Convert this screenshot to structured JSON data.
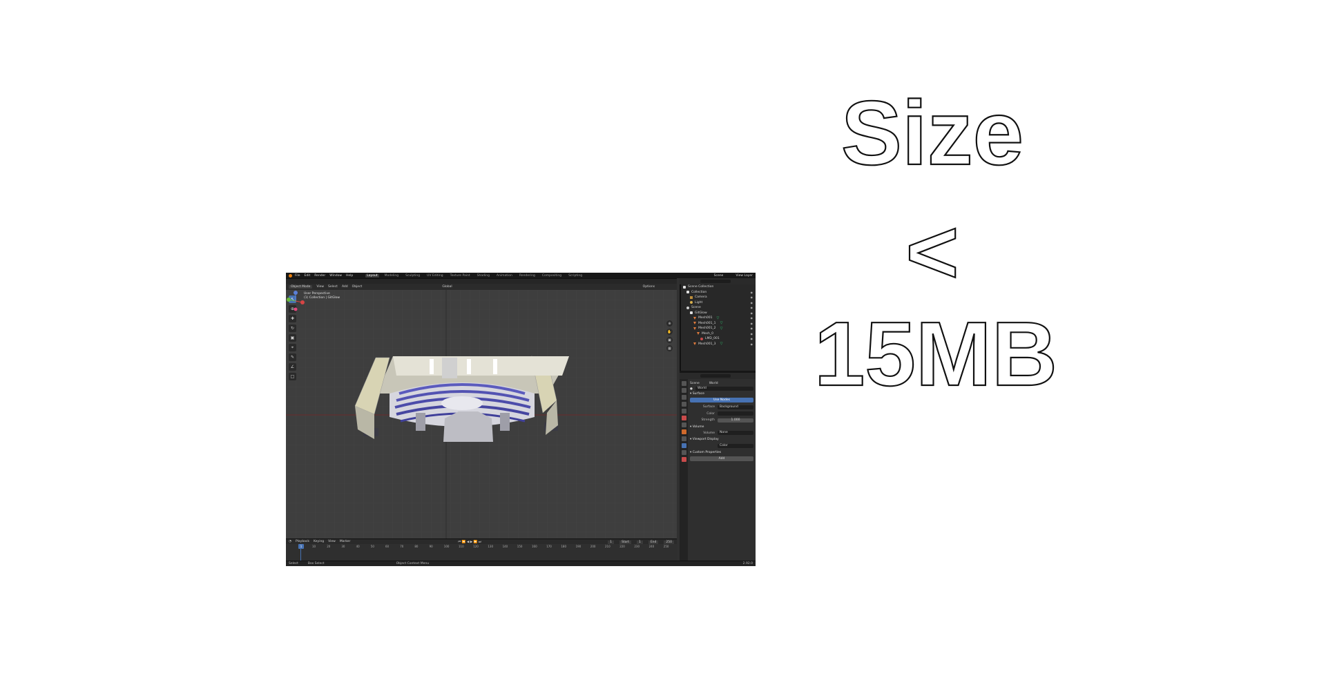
{
  "headline": {
    "line1": "Size",
    "line2": "<",
    "line3": "15MB"
  },
  "blender": {
    "menus": [
      "File",
      "Edit",
      "Render",
      "Window",
      "Help"
    ],
    "workspaces": [
      "Layout",
      "Modeling",
      "Sculpting",
      "UV Editing",
      "Texture Paint",
      "Shading",
      "Animation",
      "Rendering",
      "Compositing",
      "Scripting"
    ],
    "active_workspace": "Layout",
    "scene_name": "Scene",
    "view_layer": "View Layer",
    "viewport_header": {
      "mode": "Object Mode",
      "items": [
        "View",
        "Select",
        "Add",
        "Object"
      ],
      "transform": "Global",
      "options": "Options"
    },
    "viewport_info": {
      "line1": "User Perspective",
      "line2": "(1) Collection | GitGlow"
    },
    "timeline": {
      "menus": [
        "Playback",
        "Keying",
        "View",
        "Marker"
      ],
      "current_frame": "1",
      "start_label": "Start",
      "start_value": "1",
      "end_label": "End",
      "end_value": "250",
      "ticks": [
        "10",
        "20",
        "30",
        "40",
        "50",
        "60",
        "70",
        "80",
        "90",
        "100",
        "110",
        "120",
        "130",
        "140",
        "150",
        "160",
        "170",
        "180",
        "190",
        "200",
        "210",
        "220",
        "230",
        "240",
        "250"
      ]
    },
    "status": {
      "select": "Select",
      "box_select": "Box Select",
      "context_menu": "Object Context Menu",
      "version": "2.92.0"
    },
    "outliner": {
      "rows": [
        {
          "label": "Scene Collection",
          "indent": 0,
          "icon": "collection-icon"
        },
        {
          "label": "Collection",
          "indent": 1,
          "icon": "collection-icon"
        },
        {
          "label": "Camera",
          "indent": 2,
          "icon": "camera-icon"
        },
        {
          "label": "Light",
          "indent": 2,
          "icon": "light-icon"
        },
        {
          "label": "Scene",
          "indent": 1,
          "icon": "scene-icon"
        },
        {
          "label": "GitGlow",
          "indent": 2,
          "icon": "empty-icon"
        },
        {
          "label": "Mesh001",
          "indent": 3,
          "icon": "mesh-icon"
        },
        {
          "label": "Mesh001_1",
          "indent": 3,
          "icon": "mesh-icon"
        },
        {
          "label": "Mesh001_2",
          "indent": 3,
          "icon": "mesh-icon"
        },
        {
          "label": "Mesh_0",
          "indent": 4,
          "icon": "mesh-data-icon"
        },
        {
          "label": "LMD_001",
          "indent": 5,
          "icon": "material-icon"
        },
        {
          "label": "Mesh001_3",
          "indent": 3,
          "icon": "mesh-icon"
        }
      ]
    },
    "properties": {
      "context_scene": "Scene",
      "context_world": "World",
      "world_name": "World",
      "surface_section": "Surface",
      "use_nodes": "Use Nodes",
      "surface_label": "Surface",
      "surface_value": "Background",
      "color_label": "Color",
      "strength_label": "Strength",
      "strength_value": "1.000",
      "volume_section": "Volume",
      "volume_label": "Volume",
      "volume_value": "None",
      "viewport_display_section": "Viewport Display",
      "viewport_display_value": "Color",
      "custom_props_section": "Custom Properties",
      "add_button": "Add"
    },
    "colors": {
      "accent": "#4772b3",
      "background": "#303030",
      "viewport": "#3e3e3e"
    }
  }
}
